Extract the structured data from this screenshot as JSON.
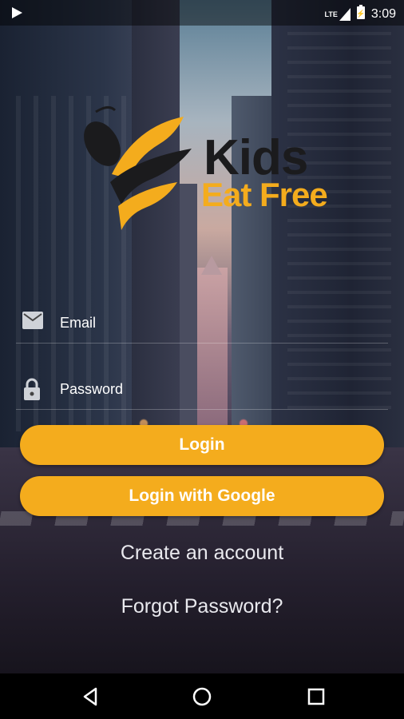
{
  "status_bar": {
    "network": "LTE",
    "time": "3:09"
  },
  "logo": {
    "word1": "Kids",
    "word2": "Eat Free"
  },
  "form": {
    "email_label": "Email",
    "password_label": "Password"
  },
  "buttons": {
    "login": "Login",
    "google": "Login with Google"
  },
  "links": {
    "create_account": "Create an account",
    "forgot_password": "Forgot Password?"
  },
  "colors": {
    "accent": "#f4ac1d",
    "logo_dark": "#1b1b1d"
  },
  "icons": [
    "play-store-icon",
    "lte-signal-icon",
    "battery-icon",
    "email-icon",
    "lock-icon",
    "back-icon",
    "home-icon",
    "recents-icon"
  ]
}
